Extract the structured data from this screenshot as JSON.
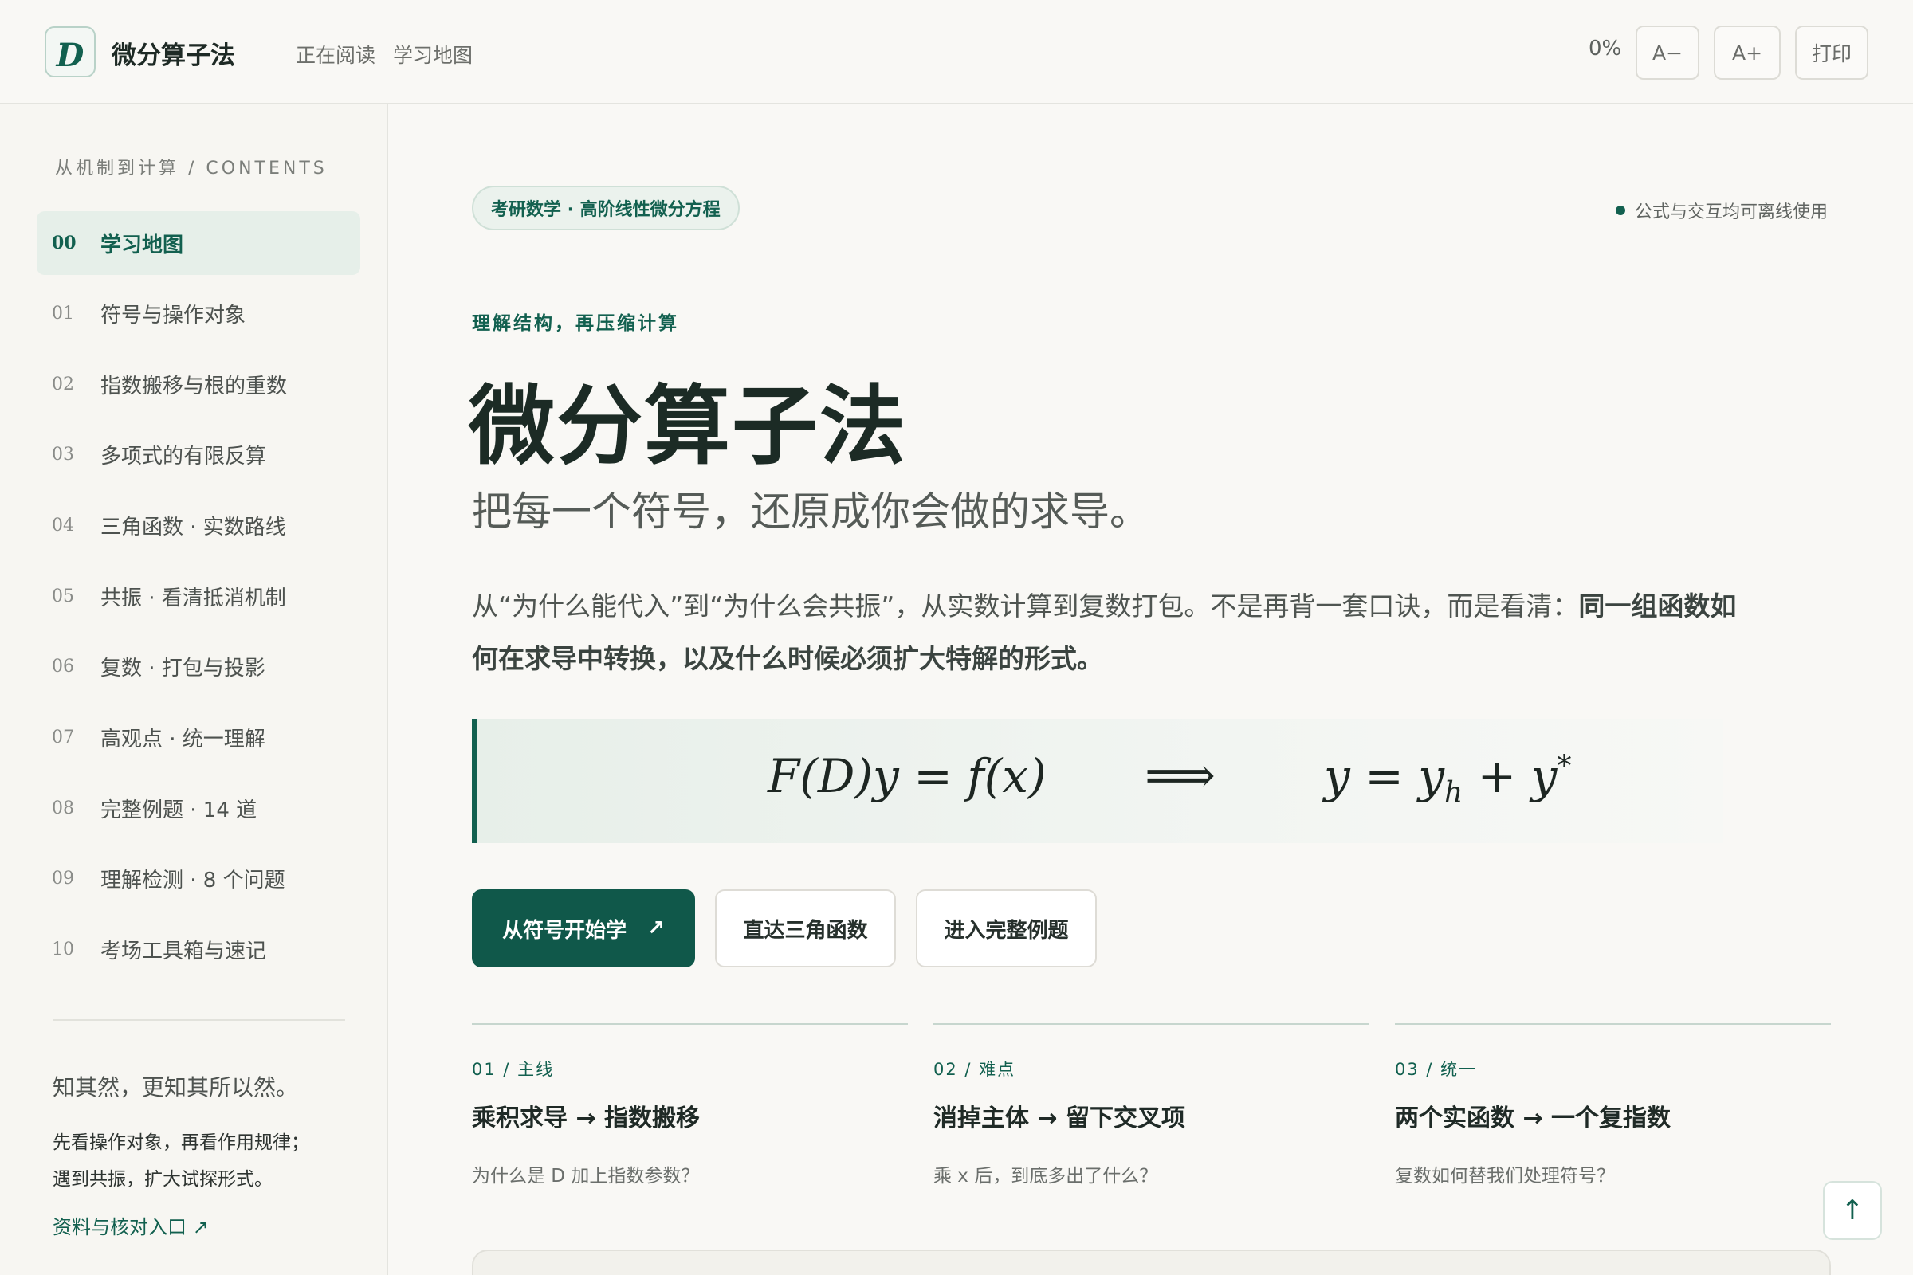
{
  "header": {
    "logo_letter": "D",
    "brand": "微分算子法",
    "nav": [
      "正在阅读",
      "学习地图"
    ],
    "progress": "0%",
    "font_smaller": "A−",
    "font_larger": "A+",
    "print": "打印"
  },
  "sidebar": {
    "heading": "从机制到计算 / CONTENTS",
    "items": [
      {
        "num": "00",
        "label": "学习地图",
        "active": true
      },
      {
        "num": "01",
        "label": "符号与操作对象"
      },
      {
        "num": "02",
        "label": "指数搬移与根的重数"
      },
      {
        "num": "03",
        "label": "多项式的有限反算"
      },
      {
        "num": "04",
        "label": "三角函数 · 实数路线"
      },
      {
        "num": "05",
        "label": "共振 · 看清抵消机制"
      },
      {
        "num": "06",
        "label": "复数 · 打包与投影"
      },
      {
        "num": "07",
        "label": "高观点 · 统一理解"
      },
      {
        "num": "08",
        "label": "完整例题 · 14 道"
      },
      {
        "num": "09",
        "label": "理解检测 · 8 个问题"
      },
      {
        "num": "10",
        "label": "考场工具箱与速记"
      }
    ],
    "quote": "知其然，更知其所以然。",
    "note_line1": "先看操作对象，再看作用规律；",
    "note_line2": "遇到共振，扩大试探形式。",
    "link": "资料与核对入口 ↗"
  },
  "main": {
    "pill": "考研数学 · 高阶线性微分方程",
    "offline_note": "公式与交互均可离线使用",
    "eyebrow": "理解结构，再压缩计算",
    "title": "微分算子法",
    "subtitle": "把每一个符号，还原成你会做的求导。",
    "lead_text": "从“为什么能代入”到“为什么会共振”，从实数计算到复数打包。不是再背一套口诀，而是看清：",
    "lead_bold": "同一组函数如何在求导中转换，以及什么时候必须扩大特解的形式。",
    "formula": {
      "lhs": "F(D)y = f(x)",
      "arrow": "⟹",
      "rhs_y": "y = y",
      "rhs_sub": "h",
      "rhs_mid": " + y",
      "rhs_sup": "*"
    },
    "buttons": {
      "primary": "从符号开始学",
      "primary_icon": "↗",
      "trig": "直达三角函数",
      "examples": "进入完整例题"
    },
    "cards": [
      {
        "tag": "01 / 主线",
        "title": "乘积求导 → 指数搬移",
        "sub": "为什么是 D 加上指数参数？"
      },
      {
        "tag": "02 / 难点",
        "title": "消掉主体 → 留下交叉项",
        "sub": "乘 x 后，到底多出了什么？"
      },
      {
        "tag": "03 / 统一",
        "title": "两个实函数 → 一个复指数",
        "sub": "复数如何替我们处理符号？"
      }
    ],
    "to_top": "↑"
  },
  "colors": {
    "accent": "#12604f",
    "primary_button": "#10584a",
    "background": "#f9f8f5",
    "active_item_bg": "#e6efe9"
  }
}
